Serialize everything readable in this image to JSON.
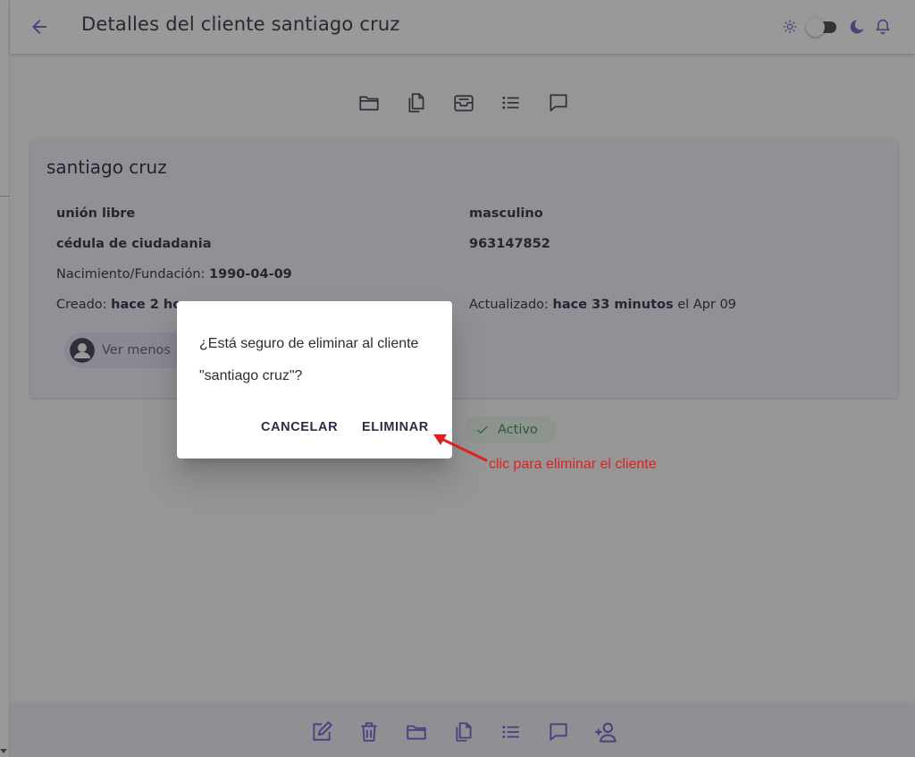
{
  "header": {
    "title": "Detalles del cliente santiago cruz",
    "back_icon": "arrow-left-icon",
    "accent_color": "#7e57c2"
  },
  "top_toolbar": [
    "folder-icon",
    "copy-documents-icon",
    "archive-inbox-icon",
    "list-icon",
    "comment-icon"
  ],
  "client": {
    "name": "santiago cruz",
    "marital_status": "unión libre",
    "gender": "masculino",
    "document_type": "cédula de ciudadania",
    "document_number": "963147852",
    "birth_label": "Nacimiento/Fundación:",
    "birth_date": "1990-04-09",
    "created_label": "Creado:",
    "created_value": "hace 2 ho",
    "updated_label": "Actualizado:",
    "updated_value": "hace 33 minutos",
    "updated_suffix": "el Apr 09",
    "toggle_label": "Ver menos",
    "status": "Activo",
    "status_color": "#43a047"
  },
  "dialog": {
    "message": "¿Está seguro de eliminar al cliente \"santiago cruz\"?",
    "cancel_label": "CANCELAR",
    "confirm_label": "ELIMINAR"
  },
  "annotation": {
    "text": "clic para eliminar el cliente",
    "color": "#e02020"
  },
  "bottom_bar": [
    "edit-icon",
    "trash-icon",
    "folder-icon",
    "copy-documents-icon",
    "list-icon",
    "comment-icon",
    "add-user-icon"
  ]
}
